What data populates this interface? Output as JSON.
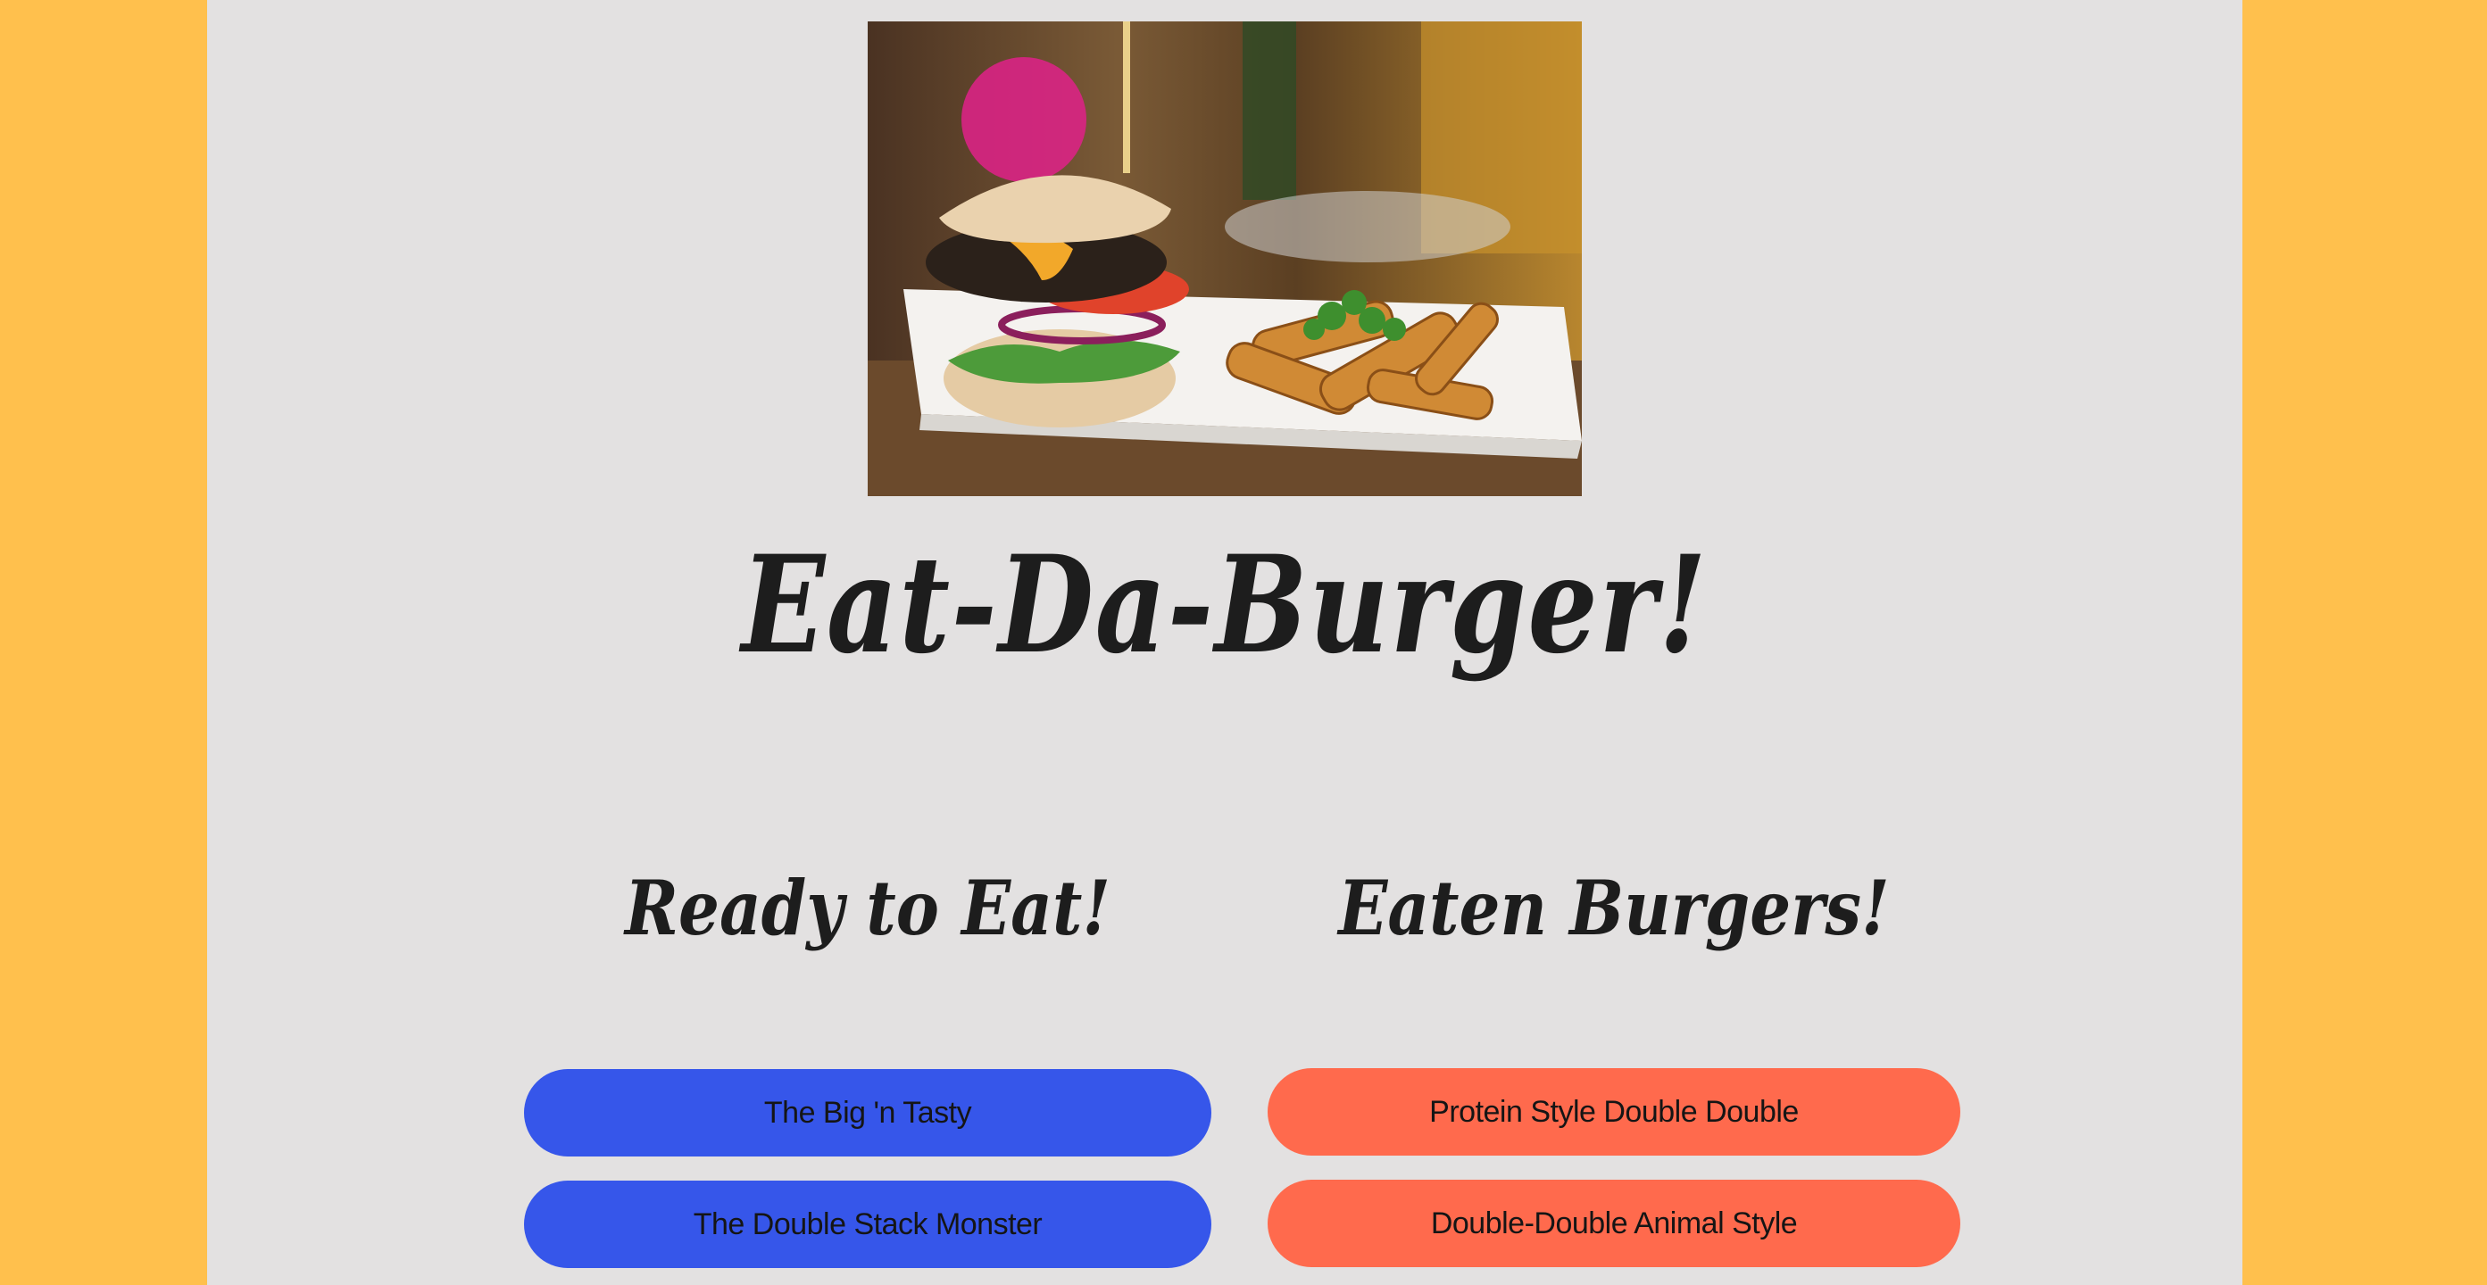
{
  "app": {
    "title": "Eat-Da-Burger!"
  },
  "hero": {
    "alt": "Burger with fries on a white plate"
  },
  "ready": {
    "heading": "Ready to Eat!",
    "items": [
      {
        "label": "The Big 'n Tasty"
      },
      {
        "label": "The Double Stack Monster"
      }
    ]
  },
  "eaten": {
    "heading": "Eaten Burgers!",
    "items": [
      {
        "label": "Protein Style Double Double"
      },
      {
        "label": "Double-Double Animal Style"
      }
    ]
  },
  "colors": {
    "background": "#FFC04D",
    "panel": "#E3E1E1",
    "ready_button": "#3656EA",
    "eaten_button": "#FF6A4D",
    "text": "#1D1D1D"
  }
}
